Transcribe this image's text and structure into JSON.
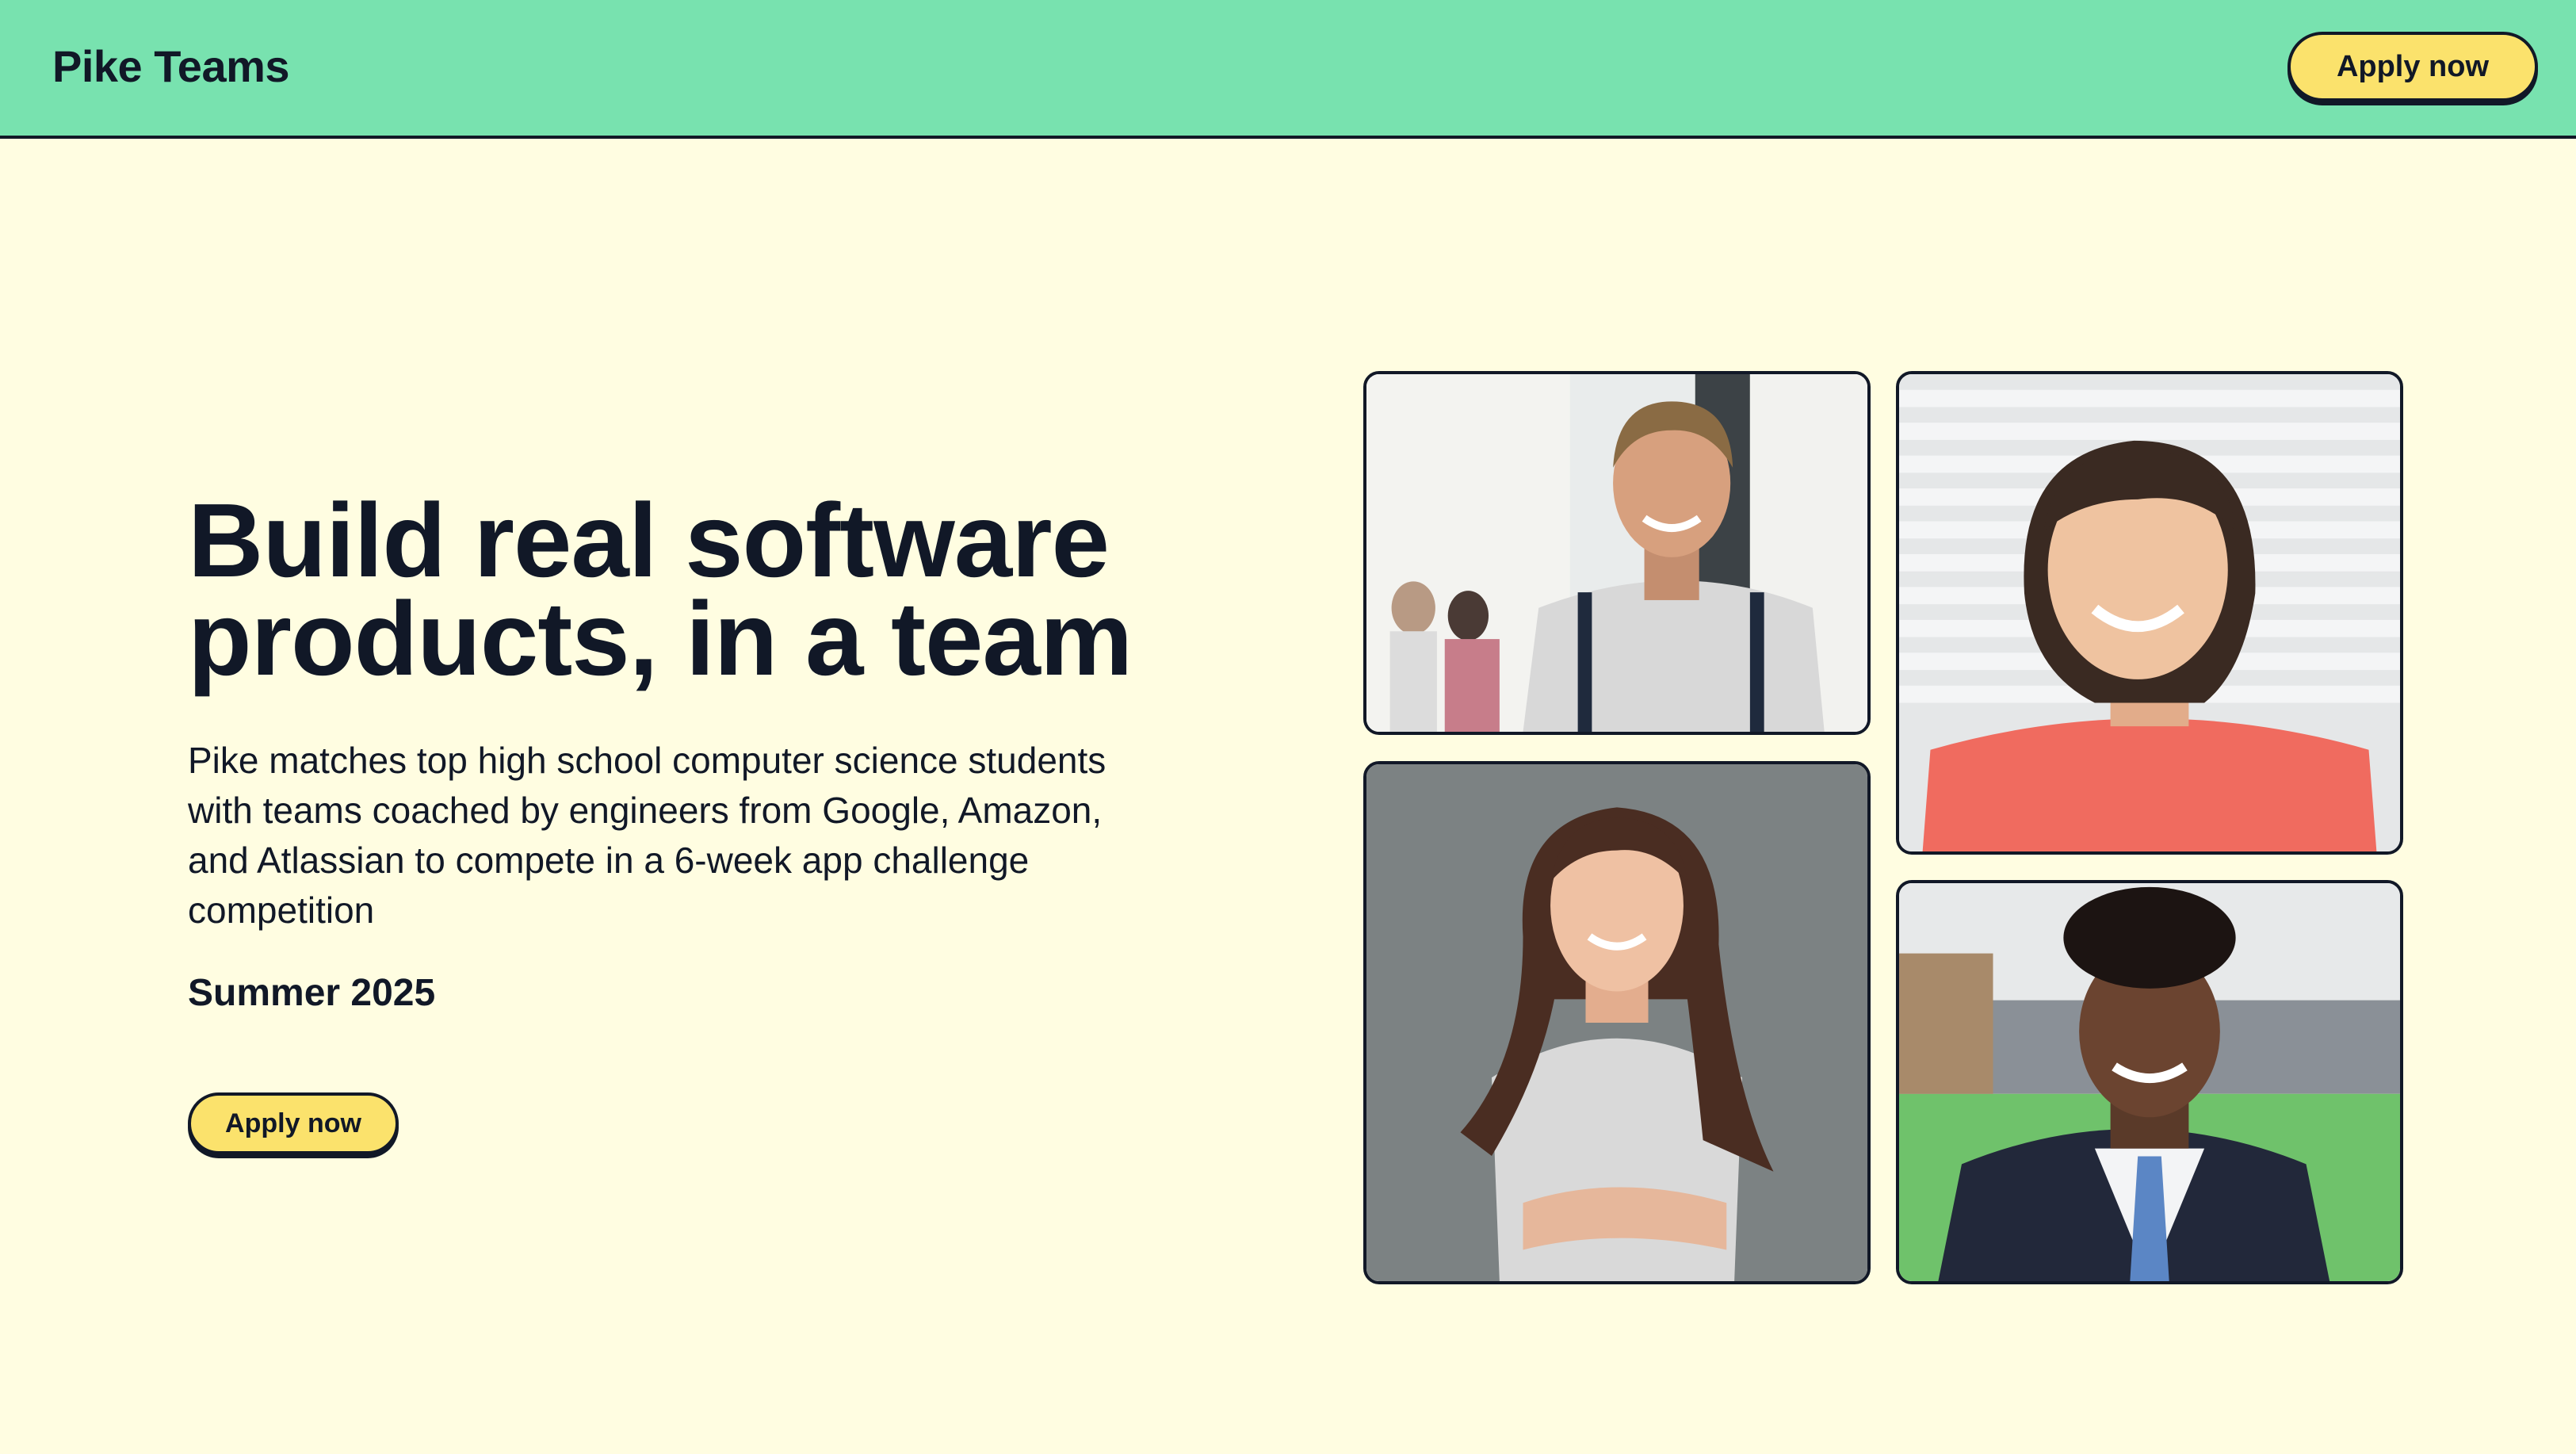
{
  "navbar": {
    "brand": "Pike Teams",
    "apply_label": "Apply now"
  },
  "hero": {
    "title_line1": "Build real software",
    "title_line2": "products, in a team",
    "description": "Pike matches top high school computer science students with teams coached by engineers from Google, Amazon, and Atlassian to compete in a 6-week app challenge competition",
    "season": "Summer 2025",
    "apply_label": "Apply now"
  },
  "colors": {
    "navbar_bg": "#78e2af",
    "page_bg": "#fffde1",
    "button_bg": "#fbe26c",
    "text": "#111827"
  }
}
